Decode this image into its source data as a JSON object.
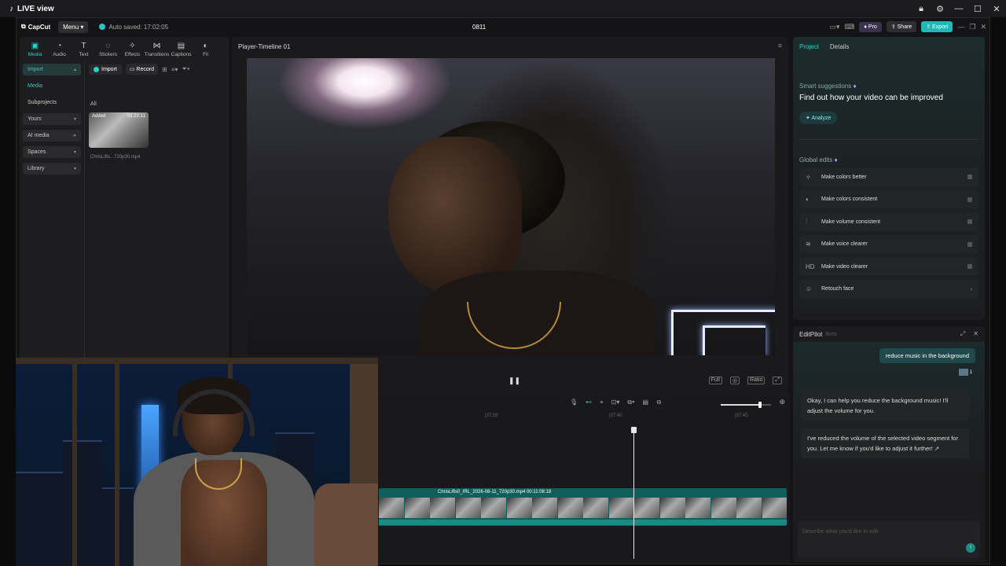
{
  "window": {
    "title": "LIVE view",
    "controls": [
      "lock-icon",
      "gear-icon",
      "minimize-icon",
      "maximize-icon",
      "close-icon"
    ]
  },
  "topbar": {
    "brand": "CapCut",
    "menu_label": "Menu",
    "autosave": "Auto saved: 17:02:05",
    "project_name": "0811",
    "pro_label": "Pro",
    "share_label": "Share",
    "export_label": "Export"
  },
  "media_tabs": [
    {
      "label": "Media",
      "icon": "media-icon",
      "active": true
    },
    {
      "label": "Audio",
      "icon": "audio-icon"
    },
    {
      "label": "Text",
      "icon": "text-icon"
    },
    {
      "label": "Stickers",
      "icon": "sticker-icon"
    },
    {
      "label": "Effects",
      "icon": "effects-icon"
    },
    {
      "label": "Transitions",
      "icon": "transitions-icon"
    },
    {
      "label": "Captions",
      "icon": "captions-icon"
    },
    {
      "label": "Fil",
      "icon": "filter-icon"
    }
  ],
  "sidebar": [
    {
      "label": "Import",
      "style": "hl",
      "chevron": "▴"
    },
    {
      "label": "Media",
      "style": "green"
    },
    {
      "label": "Subprojects",
      "style": "plain"
    },
    {
      "label": "Yours",
      "style": "box",
      "chevron": "▾"
    },
    {
      "label": "AI media",
      "style": "box",
      "chevron": "➜"
    },
    {
      "label": "Spaces",
      "style": "box",
      "chevron": "▾"
    },
    {
      "label": "Library",
      "style": "box",
      "chevron": "▾"
    }
  ],
  "media_toolbar": {
    "import_label": "Import",
    "record_label": "Record"
  },
  "media": {
    "filter_label": "All",
    "item": {
      "badge": "Added",
      "duration": "01:22:11",
      "name": "ChrisLifts...720p30.mp4"
    }
  },
  "player": {
    "title": "Player-Timeline 01",
    "buttons": [
      "Full",
      "Ratio"
    ]
  },
  "right_panel": {
    "tabs": [
      {
        "label": "Project",
        "active": true
      },
      {
        "label": "Details"
      }
    ],
    "smart_label": "Smart suggestions",
    "headline": "Find out how your video can be improved",
    "analyze_label": "Analyze",
    "global_label": "Global edits",
    "edits": [
      {
        "label": "Make colors better",
        "icon": "magic-wand-icon",
        "glyph": "✧",
        "control": "toggle"
      },
      {
        "label": "Make colors consistent",
        "icon": "palette-icon",
        "glyph": "◐",
        "control": "toggle"
      },
      {
        "label": "Make volume consistent",
        "icon": "sliders-icon",
        "glyph": "⫶",
        "control": "toggle"
      },
      {
        "label": "Make voice clearer",
        "icon": "waveform-icon",
        "glyph": "≋",
        "control": "toggle"
      },
      {
        "label": "Make video clearer",
        "icon": "hd-icon",
        "glyph": "HD",
        "control": "toggle"
      },
      {
        "label": "Retouch face",
        "icon": "face-icon",
        "glyph": "☺",
        "control": "arrow"
      }
    ]
  },
  "editpilot": {
    "title": "EditPilot",
    "beta": "Beta",
    "user_message": "reduce music in the background",
    "user_attachment_count": "1",
    "assistant_messages": [
      "Okay, I can help you reduce the background music! I'll adjust the volume for you.",
      "I've reduced the volume of the selected video segment for you. Let me know if you'd like to adjust it further! ↗"
    ],
    "input_placeholder": "Describe what you'd like to edit"
  },
  "timeline": {
    "ticks": [
      "|37:35",
      "|37:40",
      "|37:45"
    ],
    "clip_label": "ChrisLifts0_IRL_2026-08-11_720p30.mp4   00:11:08:18",
    "zoom_level": 0.78
  },
  "colors": {
    "accent": "#2bd0c8",
    "export": "#22b8b8",
    "track": "#0f5f5a"
  }
}
